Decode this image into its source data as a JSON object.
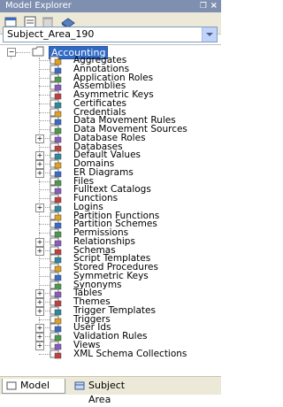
{
  "window": {
    "title": "Model Explorer",
    "pin_glyph": "❐",
    "close_glyph": "×"
  },
  "toolbar": {
    "buttons": [
      "new-window-icon",
      "properties-icon",
      "delete-icon",
      "model-icon"
    ]
  },
  "subject_area_selector": {
    "value": "Subject_Area_190"
  },
  "tree": {
    "root": {
      "label": "Accounting",
      "expanded": true
    },
    "items": [
      {
        "label": "Aggregates",
        "icon": "aggregate-icon",
        "expandable": false
      },
      {
        "label": "Annotations",
        "icon": "annotation-icon",
        "expandable": false
      },
      {
        "label": "Application Roles",
        "icon": "role-icon",
        "expandable": false
      },
      {
        "label": "Assemblies",
        "icon": "assembly-icon",
        "expandable": false
      },
      {
        "label": "Asymmetric Keys",
        "icon": "key-icon",
        "expandable": false
      },
      {
        "label": "Certificates",
        "icon": "certificate-icon",
        "expandable": false
      },
      {
        "label": "Credentials",
        "icon": "credential-icon",
        "expandable": false
      },
      {
        "label": "Data Movement Rules",
        "icon": "rule-icon",
        "expandable": false
      },
      {
        "label": "Data Movement Sources",
        "icon": "source-icon",
        "expandable": false
      },
      {
        "label": "Database Roles",
        "icon": "role-icon",
        "expandable": true
      },
      {
        "label": "Databases",
        "icon": "database-icon",
        "expandable": false
      },
      {
        "label": "Default Values",
        "icon": "default-icon",
        "expandable": true
      },
      {
        "label": "Domains",
        "icon": "domain-icon",
        "expandable": true
      },
      {
        "label": "ER Diagrams",
        "icon": "diagram-icon",
        "expandable": true
      },
      {
        "label": "Files",
        "icon": "file-icon",
        "expandable": false
      },
      {
        "label": "Fulltext Catalogs",
        "icon": "catalog-icon",
        "expandable": false
      },
      {
        "label": "Functions",
        "icon": "function-icon",
        "expandable": false
      },
      {
        "label": "Logins",
        "icon": "login-icon",
        "expandable": true
      },
      {
        "label": "Partition Functions",
        "icon": "partition-icon",
        "expandable": false
      },
      {
        "label": "Partition Schemes",
        "icon": "partition-icon",
        "expandable": false
      },
      {
        "label": "Permissions",
        "icon": "permission-icon",
        "expandable": false
      },
      {
        "label": "Relationships",
        "icon": "relationship-icon",
        "expandable": true
      },
      {
        "label": "Schemas",
        "icon": "schema-icon",
        "expandable": true
      },
      {
        "label": "Script Templates",
        "icon": "script-icon",
        "expandable": false
      },
      {
        "label": "Stored Procedures",
        "icon": "procedure-icon",
        "expandable": false
      },
      {
        "label": "Symmetric Keys",
        "icon": "key-icon",
        "expandable": false
      },
      {
        "label": "Synonyms",
        "icon": "synonym-icon",
        "expandable": false
      },
      {
        "label": "Tables",
        "icon": "table-icon",
        "expandable": true
      },
      {
        "label": "Themes",
        "icon": "theme-icon",
        "expandable": true
      },
      {
        "label": "Trigger Templates",
        "icon": "trigger-icon",
        "expandable": true
      },
      {
        "label": "Triggers",
        "icon": "trigger-icon",
        "expandable": false
      },
      {
        "label": "User Ids",
        "icon": "user-icon",
        "expandable": true
      },
      {
        "label": "Validation Rules",
        "icon": "validation-icon",
        "expandable": true
      },
      {
        "label": "Views",
        "icon": "view-icon",
        "expandable": true
      },
      {
        "label": "XML Schema Collections",
        "icon": "xml-icon",
        "expandable": false
      }
    ]
  },
  "tabs": [
    {
      "label": "Model",
      "active": true,
      "icon": "model-tab-icon"
    },
    {
      "label": "Subject Area",
      "active": false,
      "icon": "subject-area-tab-icon"
    }
  ],
  "colors": {
    "selection": "#316ac5",
    "titlebar": "#7f8fb0",
    "chrome": "#ece9d8"
  }
}
